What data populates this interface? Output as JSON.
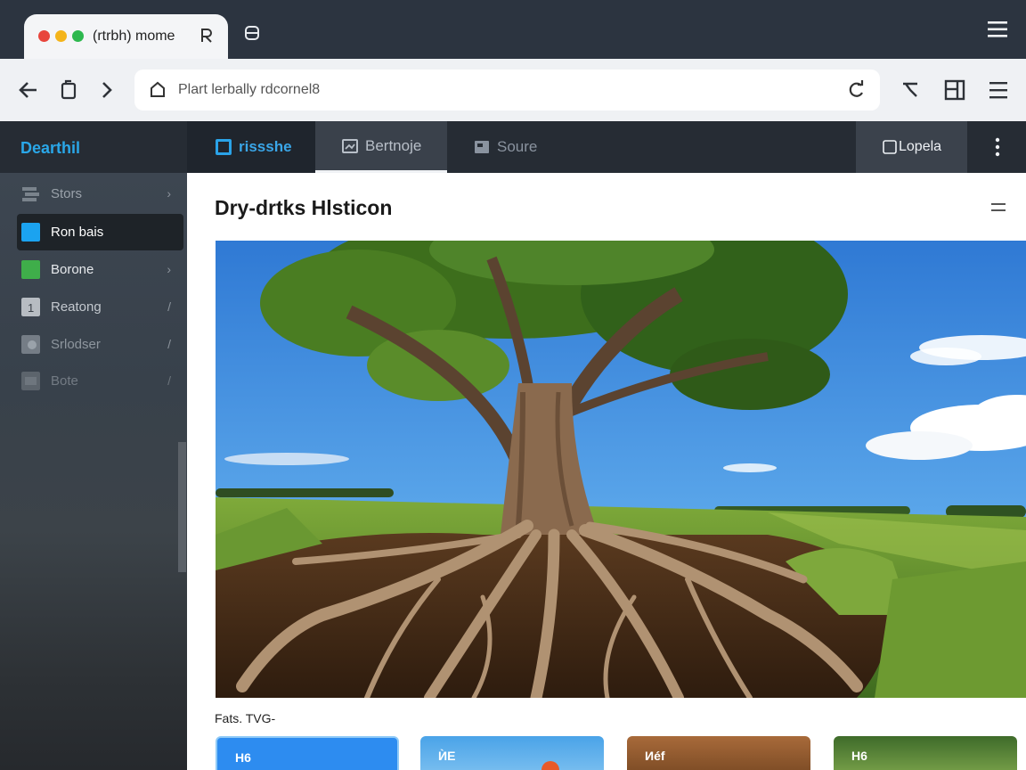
{
  "browser": {
    "tab_title": "(rtrbh) mome",
    "address_bar_text": "Plart lerbally rdcornel8",
    "traffic_lights": [
      "#e8453c",
      "#f4b41a",
      "#2db84e"
    ]
  },
  "app": {
    "brand": "Dearthil",
    "nav_tabs": [
      {
        "label": "rissshe",
        "icon": "home-square-icon",
        "state": "active"
      },
      {
        "label": "Bertnoje",
        "icon": "image-icon"
      },
      {
        "label": "Soure",
        "icon": "image-icon"
      }
    ],
    "right_button": "Lopela"
  },
  "sidebar": {
    "items": [
      {
        "label": "Stors",
        "icon": "stack-icon",
        "trail": "›"
      },
      {
        "label": "Ron bais",
        "icon": "blue-square-icon",
        "active": true
      },
      {
        "label": "Borone",
        "icon": "green-square-icon",
        "trail": "›"
      },
      {
        "label": "Reatong",
        "icon": "number-icon",
        "trail": "/"
      },
      {
        "label": "Srlodser",
        "icon": "photo-icon",
        "trail": "/"
      },
      {
        "label": "Bote",
        "icon": "box-icon",
        "trail": "/"
      }
    ]
  },
  "main": {
    "title": "Dry-drtks Hlsticon",
    "caption": "Fats. TVG-",
    "cards": [
      {
        "label": "H6"
      },
      {
        "label": "ЍЕ"
      },
      {
        "label": "Иéf"
      },
      {
        "label": "H6"
      }
    ]
  },
  "colors": {
    "accent": "#2aa7e8",
    "header_bg": "#262c34",
    "toolbar_bg": "#eff1f4"
  }
}
